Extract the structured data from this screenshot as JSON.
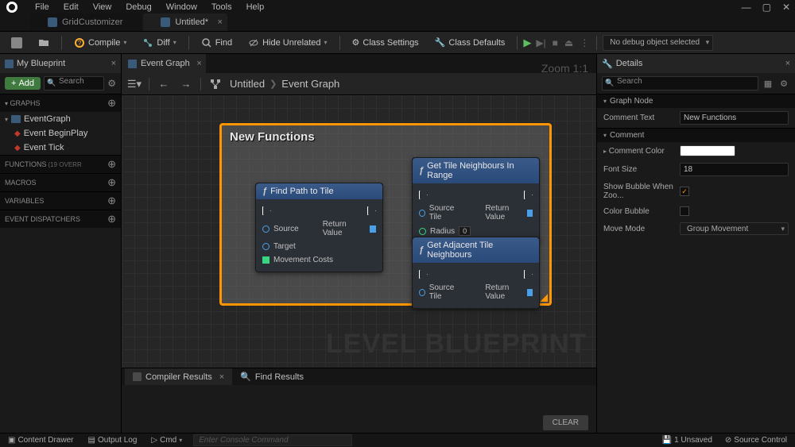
{
  "menubar": {
    "items": [
      "File",
      "Edit",
      "View",
      "Debug",
      "Window",
      "Tools",
      "Help"
    ]
  },
  "window_tabs": [
    {
      "label": "GridCustomizer",
      "active": false
    },
    {
      "label": "Untitled*",
      "active": true
    }
  ],
  "toolbar": {
    "compile": "Compile",
    "diff": "Diff",
    "find": "Find",
    "hide_unrelated": "Hide Unrelated",
    "class_settings": "Class Settings",
    "class_defaults": "Class Defaults",
    "debug_dropdown": "No debug object selected"
  },
  "left": {
    "panel_title": "My Blueprint",
    "add_label": "Add",
    "search_placeholder": "Search",
    "sections": {
      "graphs": "GRAPHS",
      "functions": "FUNCTIONS",
      "functions_sub": "(19 OVERR",
      "macros": "MACROS",
      "variables": "VARIABLES",
      "dispatchers": "EVENT DISPATCHERS"
    },
    "graph_root": "EventGraph",
    "graph_children": [
      "Event BeginPlay",
      "Event Tick"
    ]
  },
  "center": {
    "tab_label": "Event Graph",
    "breadcrumb": [
      "Untitled",
      "Event Graph"
    ],
    "zoom": "Zoom 1:1",
    "watermark": "LEVEL BLUEPRINT",
    "comment_title": "New Functions",
    "nodes": {
      "findpath": {
        "title": "Find Path to Tile",
        "source": "Source",
        "target": "Target",
        "movement_costs": "Movement Costs",
        "return_value": "Return Value"
      },
      "neighbours_range": {
        "title": "Get Tile Neighbours In Range",
        "source_tile": "Source Tile",
        "radius": "Radius",
        "radius_val": "0",
        "return_value": "Return Value"
      },
      "adjacent": {
        "title": "Get Adjacent Tile Neighbours",
        "source_tile": "Source Tile",
        "return_value": "Return Value"
      }
    },
    "bottom_tabs": {
      "compiler": "Compiler Results",
      "find": "Find Results"
    },
    "clear": "CLEAR"
  },
  "details": {
    "title": "Details",
    "search_placeholder": "Search",
    "sec_graph_node": "Graph Node",
    "sec_comment": "Comment",
    "comment_text_label": "Comment Text",
    "comment_text_value": "New Functions",
    "comment_color_label": "Comment Color",
    "font_size_label": "Font Size",
    "font_size_value": "18",
    "show_bubble_label": "Show Bubble When Zoo...",
    "show_bubble_checked": true,
    "color_bubble_label": "Color Bubble",
    "color_bubble_checked": false,
    "move_mode_label": "Move Mode",
    "move_mode_value": "Group Movement"
  },
  "statusbar": {
    "content_drawer": "Content Drawer",
    "output_log": "Output Log",
    "cmd": "Cmd",
    "console_placeholder": "Enter Console Command",
    "unsaved": "1 Unsaved",
    "source_control": "Source Control"
  }
}
